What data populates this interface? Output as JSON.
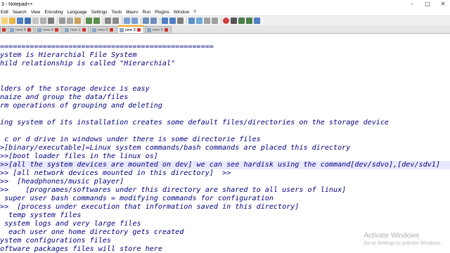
{
  "window": {
    "title": "3 - Notepad++",
    "minimize": "–",
    "maximize": "□",
    "close": "✕"
  },
  "menu": [
    "Edit",
    "Search",
    "View",
    "Encoding",
    "Language",
    "Settings",
    "Tools",
    "Macro",
    "Run",
    "Plugins",
    "Window",
    "?"
  ],
  "tabs": [
    {
      "label": "",
      "active": false
    },
    {
      "label": "new 5",
      "active": false
    },
    {
      "label": "new 4",
      "active": false
    },
    {
      "label": "new 1",
      "active": false
    },
    {
      "label": "new 2",
      "active": false
    },
    {
      "label": "new 3",
      "active": true
    },
    {
      "label": "new 6",
      "active": false
    }
  ],
  "editor": {
    "lines": [
      "==================================================",
      "ystem is Hierarchial File System",
      "hild relationship is called \"Hierarchial\"",
      "",
      "",
      "lders of the storage device is easy",
      "naize and group the data/files",
      "rm operations of grouping and deleting",
      "",
      "ing system of its installation creates some default files/directories on the storage device",
      "",
      " c or d drive in windows under there is some directorie files",
      ">[binary/executable]=Linux system commands/bash commands are placed this directory",
      ">>[boot loader files in the linux os]",
      ">>[all the system devices are mounted on dev] we can see hardisk using the command[dev/sdvo],[dev/sdv1]",
      ">> [all network devices mounted in this directory]  >>",
      ">>  [headphones/music player]",
      ">>    [programes/softwares under this directory are shared to all users of linux]",
      " super user bash commands = modifying commands for configuration",
      ">>  [process under execution that information saved in this directory]",
      "  temp system files",
      " system logs and very large files",
      "  each user one home directory gets created",
      "ystem configurations files",
      "oftware packages files will store here"
    ],
    "current_line": 14
  },
  "watermark": {
    "title": "Activate Windows",
    "subtitle": "Go to Settings to activate Windows."
  },
  "colors": {
    "text": "#000080",
    "current_line_bg": "#e8e8ff",
    "active_tab_accent": "#f5a623"
  }
}
